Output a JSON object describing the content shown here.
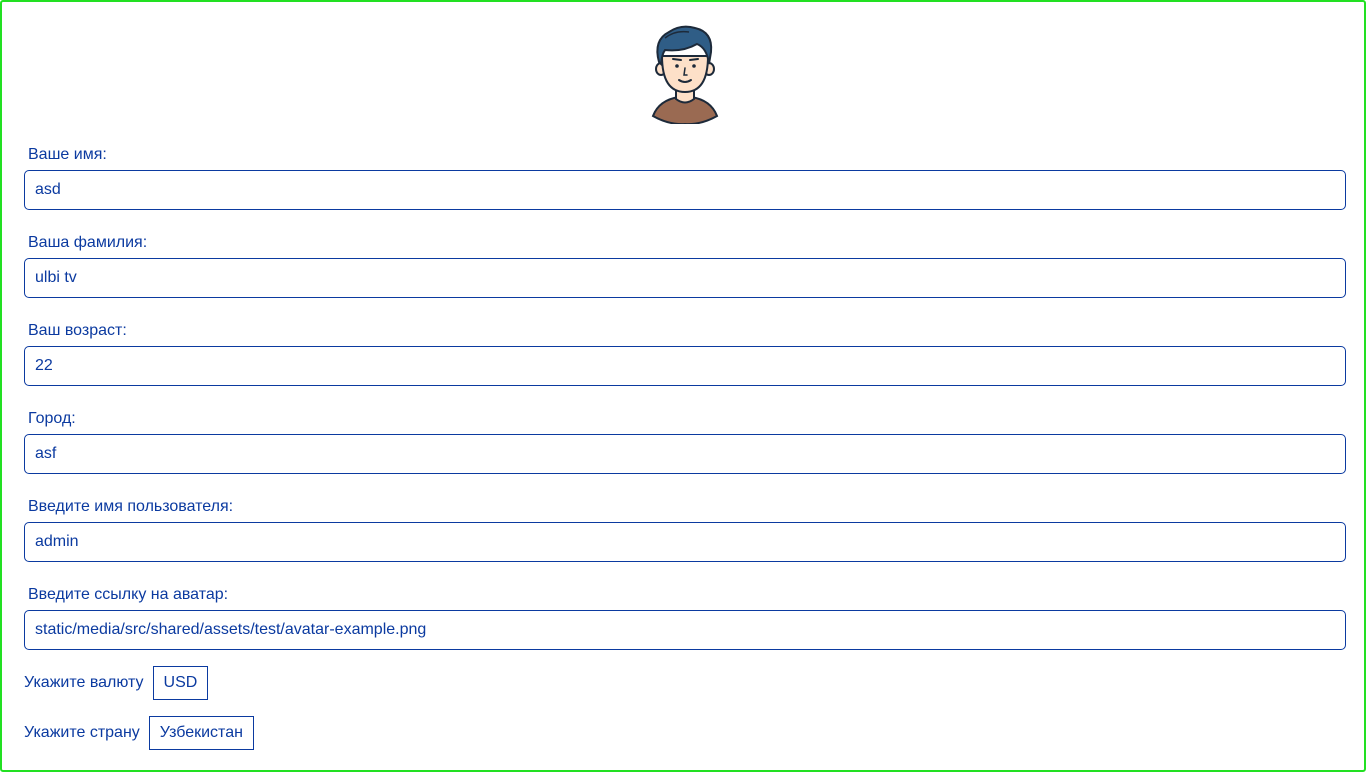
{
  "profile": {
    "avatar_icon": "user-avatar-icon",
    "fields": [
      {
        "label": "Ваше имя:",
        "value": "asd"
      },
      {
        "label": "Ваша фамилия:",
        "value": "ulbi tv"
      },
      {
        "label": "Ваш возраст:",
        "value": "22"
      },
      {
        "label": "Город:",
        "value": "asf"
      },
      {
        "label": "Введите имя пользователя:",
        "value": "admin"
      },
      {
        "label": "Введите ссылку на аватар:",
        "value": "static/media/src/shared/assets/test/avatar-example.png"
      }
    ],
    "currency": {
      "label": "Укажите валюту",
      "value": "USD"
    },
    "country": {
      "label": "Укажите страну",
      "value": "Узбекистан"
    }
  },
  "colors": {
    "accent": "#0b3aa0",
    "frame_border": "#22e022",
    "background": "#ffffff"
  }
}
